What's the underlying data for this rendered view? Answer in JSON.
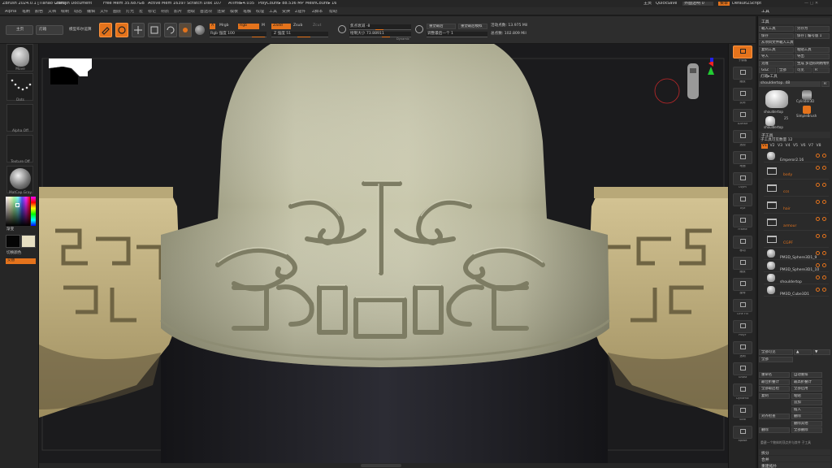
{
  "titlebar": {
    "app": "ZBrush 2024.0.1 [Tianao Chen]",
    "document": "ZBrush Document",
    "free_mem": "Free Mem 35.687GB",
    "active_mem": "Active Mem 16397",
    "scratch": "Scratch Disk 107",
    "atime": "ATime▸4.035",
    "polycount": "PolyCount▸ 88.536 MP",
    "meshcount": "MeshCount▸ 16",
    "homepage": "主页",
    "quicksave": "QuickSave",
    "transparency": "界面透明 0",
    "menus_btn": "菜单",
    "script": "DefaultZScript"
  },
  "menubar": {
    "items": [
      "Alpha",
      "笔刷",
      "颜色",
      "文档",
      "绘制",
      "动态",
      "编辑",
      "文件",
      "图层",
      "灯光",
      "宏",
      "标记",
      "材质",
      "影片",
      "拾取",
      "首选项",
      "渲染",
      "模板",
      "笔触",
      "纹理",
      "工具",
      "变换",
      "Z插件",
      "Z脚本",
      "帮助"
    ],
    "tool_title": "工具"
  },
  "shelf": {
    "lightbox": "主页",
    "lightbox2": "灯箱",
    "live_boolean": "模型布尔运算",
    "mode_buttons": [
      "编辑",
      "绘制",
      "移动",
      "缩放",
      "旋转"
    ],
    "a_chip": "A",
    "mrgb": "Mrgb",
    "rgb_chip": "Rgb",
    "m_label": "M",
    "zadd": "Zadd",
    "zsub": "Zsub",
    "zcut": "Zcut",
    "rgb_intensity": "Rgb 强度 100",
    "z_intensity": "Z 强度 51",
    "focal_shift": "焦点衰减 -8",
    "draw_size": "绘制大小 73.88911",
    "dynamic": "Dynamic",
    "persp": "重塑最后",
    "persp2": "重塑最后模拟",
    "adjust": "调整最后一个 1",
    "active_points": "活动点数: 13.975 Mil",
    "total_points": "总点数: 102.809 Mil"
  },
  "left_tray": {
    "brush": "Move",
    "stroke": "Dots",
    "alpha": "Alpha Off",
    "texture": "Texture Off",
    "material": "MatCap Gray",
    "gradient": "渐变",
    "switch_color": "切换颜色",
    "alternate": "交替"
  },
  "right_toolbar": {
    "buttons": [
      "子像素",
      "缩放",
      "实际",
      "AAHalf",
      "透视",
      "地面",
      "Lsym",
      "Xyz",
      "Frame",
      "移动",
      "缩放",
      "旋转",
      "Line Fill",
      "PolyF",
      "透明",
      "Ghost",
      "Dynamic",
      "Solo",
      "Xpose"
    ],
    "active": "子像素"
  },
  "right_panel": {
    "tool_header": "工具",
    "buttons": [
      [
        "载入工具",
        "另存为"
      ],
      [
        "保存",
        "保存 | 编号版 1"
      ],
      [
        "从项目文件载入工具",
        ""
      ],
      [
        "复制工具",
        "粘贴工具"
      ],
      [
        "导入",
        "导出"
      ],
      [
        "克隆",
        "生成 多边形网格物体"
      ],
      [
        "GoZ",
        "全部",
        "可见",
        "R"
      ]
    ],
    "lightbox_tools": "灯箱▸工具",
    "current_tool": "shouldertop. 48",
    "r_label": "R",
    "thumbs": [
      "shouldertop",
      "Cylinder3D",
      "SimpleBrush",
      "shouldertop"
    ],
    "thumb_count": "25",
    "subtool_header": "子工具",
    "subtool_count": "子工具可见数量 12",
    "visibility_sets": [
      "V1",
      "V2",
      "V3",
      "V4",
      "V5",
      "V6",
      "V7",
      "V8"
    ],
    "subtools": [
      {
        "name": "Emperor2.16",
        "kind": "model"
      },
      {
        "name": "body",
        "kind": "folder"
      },
      {
        "name": "ccs",
        "kind": "folder"
      },
      {
        "name": "hair",
        "kind": "folder"
      },
      {
        "name": "armour",
        "kind": "folder"
      },
      {
        "name": "CGPF",
        "kind": "folder"
      },
      {
        "name": "PM3D_Sphere3D1_9",
        "kind": "model"
      },
      {
        "name": "PM3D_Sphere3D1_10",
        "kind": "model"
      },
      {
        "name": "shouldertop",
        "kind": "model"
      },
      {
        "name": "PM3D_Cube3D1",
        "kind": "model"
      }
    ],
    "list_all": "全部可见",
    "all_high": "全部",
    "bottom_buttons": [
      [
        "重命名",
        "自动重排"
      ],
      [
        "最佳折叠计",
        "最高折叠计"
      ],
      [
        "全部取启检",
        "全部启用"
      ],
      [
        "复制",
        "粘贴"
      ],
      [
        "",
        "追加"
      ],
      [
        "",
        "插入"
      ],
      [
        "对齐检查",
        "删除"
      ],
      [
        "",
        "删除其他"
      ],
      [
        "删除",
        "全部删除"
      ]
    ],
    "split": "拆分",
    "merge": "合并",
    "remesh": "重建拓扑",
    "note": "重建一个物体的顶点并与其中 子工具"
  },
  "colors": {
    "accent": "#e4731c",
    "bg": "#1d1d1d",
    "panel": "#2a2a2a",
    "model_clay": "#bbbba0",
    "armor_gold": "#cdb98a"
  }
}
